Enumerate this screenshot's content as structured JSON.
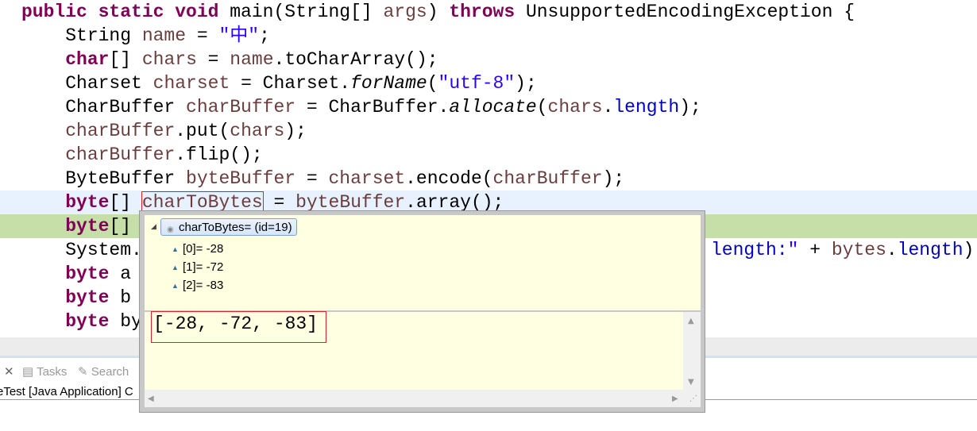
{
  "code_lines": [
    [
      [
        "k",
        "public static void "
      ],
      [
        "p",
        "main(String[] "
      ],
      [
        "v",
        "args"
      ],
      [
        "p",
        ") "
      ],
      [
        "k",
        "throws "
      ],
      [
        "p",
        "UnsupportedEncodingException {"
      ]
    ],
    [
      [
        "p",
        "    String "
      ],
      [
        "v",
        "name"
      ],
      [
        "p",
        " = "
      ],
      [
        "s",
        "\"中\""
      ],
      [
        "p",
        ";"
      ]
    ],
    [
      [
        "p",
        "    "
      ],
      [
        "k",
        "char"
      ],
      [
        "p",
        "[] "
      ],
      [
        "v",
        "chars"
      ],
      [
        "p",
        " = "
      ],
      [
        "v",
        "name"
      ],
      [
        "p",
        ".toCharArray();"
      ]
    ],
    [
      [
        "p",
        "    Charset "
      ],
      [
        "v",
        "charset"
      ],
      [
        "p",
        " = Charset."
      ],
      [
        "i",
        "forName"
      ],
      [
        "p",
        "("
      ],
      [
        "s",
        "\"utf-8\""
      ],
      [
        "p",
        ");"
      ]
    ],
    [
      [
        "p",
        "    CharBuffer "
      ],
      [
        "v",
        "charBuffer"
      ],
      [
        "p",
        " = CharBuffer."
      ],
      [
        "i",
        "allocate"
      ],
      [
        "p",
        "("
      ],
      [
        "v",
        "chars"
      ],
      [
        "p",
        "."
      ],
      [
        "f",
        "length"
      ],
      [
        "p",
        ");"
      ]
    ],
    [
      [
        "p",
        "    "
      ],
      [
        "v",
        "charBuffer"
      ],
      [
        "p",
        ".put("
      ],
      [
        "v",
        "chars"
      ],
      [
        "p",
        ");"
      ]
    ],
    [
      [
        "p",
        "    "
      ],
      [
        "v",
        "charBuffer"
      ],
      [
        "p",
        ".flip();"
      ]
    ],
    [
      [
        "p",
        "    ByteBuffer "
      ],
      [
        "v",
        "byteBuffer"
      ],
      [
        "p",
        " = "
      ],
      [
        "v",
        "charset"
      ],
      [
        "p",
        ".encode("
      ],
      [
        "v",
        "charBuffer"
      ],
      [
        "p",
        ");"
      ]
    ],
    [
      [
        "p",
        "    "
      ],
      [
        "k",
        "byte"
      ],
      [
        "p",
        "[] "
      ],
      [
        "vb",
        "charToBytes"
      ],
      [
        "p",
        " = "
      ],
      [
        "v",
        "byteBuffer"
      ],
      [
        "p",
        ".array();"
      ]
    ],
    [
      [
        "p",
        "    "
      ],
      [
        "k",
        "byte"
      ],
      [
        "p",
        "[]"
      ]
    ],
    [
      [
        "p",
        "    System."
      ]
    ],
    [
      [
        "p",
        "    "
      ],
      [
        "k",
        "byte"
      ],
      [
        "p",
        " a"
      ]
    ],
    [
      [
        "p",
        "    "
      ],
      [
        "k",
        "byte"
      ],
      [
        "p",
        " b"
      ]
    ],
    [
      [
        "p",
        "    "
      ],
      [
        "k",
        "byte"
      ],
      [
        "p",
        " by"
      ]
    ]
  ],
  "line10_tail": [
    [
      "f",
      "length:"
    ],
    [
      "s",
      "\""
    ],
    [
      "p",
      " + "
    ],
    [
      "v",
      "bytes"
    ],
    [
      "p",
      "."
    ],
    [
      "f",
      "length"
    ],
    [
      "p",
      ")"
    ]
  ],
  "popup": {
    "root": "charToBytes= (id=19)",
    "items": [
      "[0]= -28",
      "[1]= -72",
      "[2]= -83"
    ],
    "detail": "[-28, -72, -83]"
  },
  "panel": {
    "tasks": "Tasks",
    "search": "Search",
    "console": "eTest [Java Application] C"
  }
}
